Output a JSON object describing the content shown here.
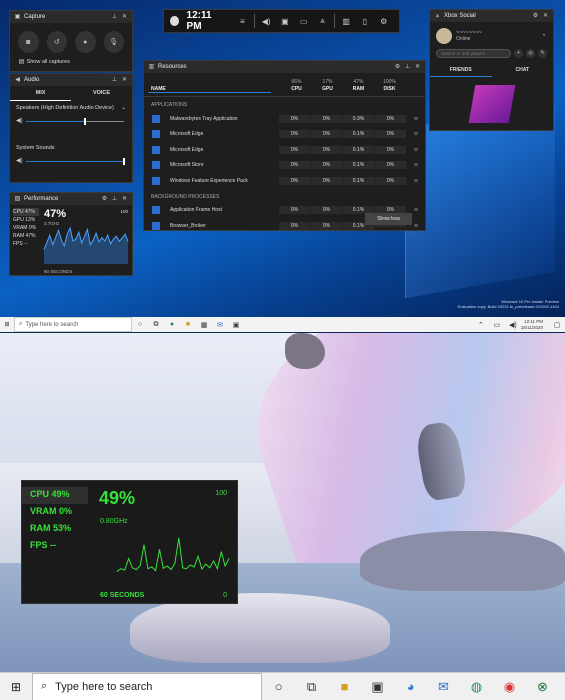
{
  "gamebar": {
    "time": "12:11 PM"
  },
  "capture": {
    "title": "Capture",
    "show_all": "Show all captures"
  },
  "audio": {
    "title": "Audio",
    "tabs": [
      "MIX",
      "VOICE"
    ],
    "device": "Speakers (High Definition Audio Device)",
    "device_level": 0.6,
    "system_label": "System Sounds",
    "system_level": 1.0
  },
  "perf_small": {
    "title": "Performance",
    "stats": [
      "CPU  47%",
      "GPU  13%",
      "VRAM  0%",
      "RAM  47%",
      "FPS  --"
    ],
    "big": "47%",
    "ghz": "3.7GHz",
    "max": "100",
    "seconds": "60 SECONDS"
  },
  "resources": {
    "title": "Resources",
    "headers": {
      "name": "NAME",
      "cpu_pct": "66%",
      "gpu_pct": "17%",
      "ram_pct": "47%",
      "disk_pct": "100%",
      "cpu": "CPU",
      "gpu": "GPU",
      "ram": "RAM",
      "disk": "DISK"
    },
    "sec_apps": "APPLICATIONS",
    "apps": [
      {
        "name": "Malwarebytes Tray Application",
        "cpu": "0%",
        "gpu": "0%",
        "ram": "0.3%",
        "disk": "0%"
      },
      {
        "name": "Microsoft Edge",
        "cpu": "0%",
        "gpu": "0%",
        "ram": "0.1%",
        "disk": "0%"
      },
      {
        "name": "Microsoft Edge",
        "cpu": "0%",
        "gpu": "0%",
        "ram": "0.1%",
        "disk": "0%"
      },
      {
        "name": "Microsoft Store",
        "cpu": "0%",
        "gpu": "0%",
        "ram": "0.1%",
        "disk": "0%"
      },
      {
        "name": "Windows Feature Experience Pack",
        "cpu": "0%",
        "gpu": "0%",
        "ram": "0.1%",
        "disk": "0%"
      }
    ],
    "sec_bg": "BACKGROUND PROCESSES",
    "bg": [
      {
        "name": "Application Frame Host",
        "cpu": "0%",
        "gpu": "0%",
        "ram": "0.1%",
        "disk": "0%"
      },
      {
        "name": "Browser_Broker",
        "cpu": "0%",
        "gpu": "0%",
        "ram": "0.1%",
        "disk": ""
      }
    ],
    "show_less": "Show less"
  },
  "social": {
    "title": "Xbox Social",
    "status": "Online",
    "search_placeholder": "Search or add players",
    "tabs": [
      "FRIENDS",
      "CHAT"
    ]
  },
  "taskbar_top": {
    "search": "Type here to search",
    "time": "12:11 PM",
    "date": "18/11/2020"
  },
  "watermark": {
    "line1": "Windows 10 Pro Insider Preview",
    "line2": "Evaluation copy. Build 20231.fe_prerelease.201002-1444"
  },
  "perf_big": {
    "stats": [
      "CPU  49%",
      "VRAM  0%",
      "RAM  53%",
      "FPS  --"
    ],
    "big": "49%",
    "ghz": "0.80GHz",
    "max": "100",
    "seconds": "60 SECONDS",
    "min": "0"
  },
  "taskbar_bottom": {
    "search": "Type here to search"
  },
  "chart_data": [
    {
      "type": "area",
      "x": [
        0,
        1,
        2,
        3,
        4,
        5,
        6,
        7,
        8,
        9,
        10,
        11,
        12,
        13,
        14,
        15,
        16,
        17,
        18,
        19,
        20,
        21,
        22,
        23,
        24,
        25,
        26,
        27,
        28,
        29
      ],
      "values": [
        30,
        45,
        60,
        40,
        55,
        70,
        50,
        38,
        62,
        75,
        48,
        52,
        66,
        44,
        58,
        72,
        40,
        50,
        64,
        46,
        55,
        48,
        60,
        42,
        52,
        58,
        47,
        54,
        62,
        47
      ],
      "ylim": [
        0,
        100
      ]
    },
    {
      "type": "line",
      "x": [
        0,
        1,
        2,
        3,
        4,
        5,
        6,
        7,
        8,
        9,
        10,
        11,
        12,
        13,
        14,
        15,
        16,
        17,
        18,
        19,
        20,
        21,
        22,
        23,
        24,
        25,
        26,
        27,
        28,
        29
      ],
      "values": [
        12,
        18,
        15,
        40,
        20,
        16,
        25,
        70,
        18,
        22,
        14,
        60,
        19,
        24,
        16,
        30,
        85,
        20,
        18,
        26,
        22,
        45,
        17,
        28,
        20,
        35,
        18,
        55,
        24,
        40
      ],
      "ylim": [
        0,
        100
      ]
    }
  ]
}
